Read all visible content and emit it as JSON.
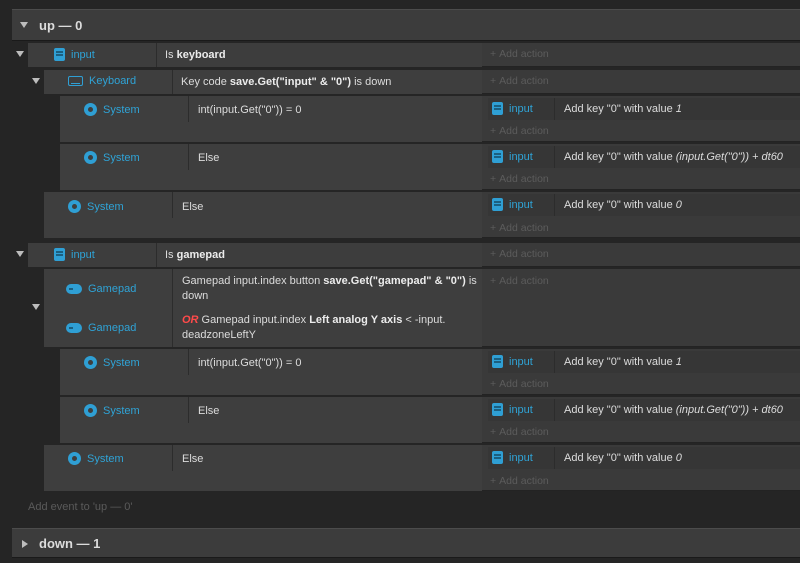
{
  "groups": [
    {
      "title": "up — 0",
      "add_event": "Add event to 'up — 0'"
    },
    {
      "title": "down — 1"
    }
  ],
  "common": {
    "add_action": "Add action",
    "plus": "+"
  },
  "events": {
    "e1": {
      "object": "input",
      "cond_prefix": "Is ",
      "cond_bold": "keyboard"
    },
    "e1a": {
      "object": "Keyboard",
      "cond_prefix": "Key code ",
      "cond_bold": "save.Get(\"input\" & \"0\")",
      "cond_suffix": " is down"
    },
    "e1a1": {
      "object": "System",
      "cond": "int(input.Get(\"0\")) = 0",
      "action_object": "input",
      "action_prefix": "Add key \"0\" with value ",
      "action_value": "1"
    },
    "e1a2": {
      "object": "System",
      "cond": "Else",
      "action_object": "input",
      "action_prefix": "Add key \"0\" with value ",
      "action_value": "(input.Get(\"0\")) + dt60"
    },
    "e1b": {
      "object": "System",
      "cond": "Else",
      "action_object": "input",
      "action_prefix": "Add key \"0\" with value ",
      "action_value": "0"
    },
    "e2": {
      "object": "input",
      "cond_prefix": "Is ",
      "cond_bold": "gamepad"
    },
    "e2a": {
      "object1": "Gamepad",
      "c1_prefix": "Gamepad input.index button ",
      "c1_bold": "save.Get(\"gamepad\" & \"0\")",
      "c1_suffix": " is",
      "c1_line2": "down",
      "object2": "Gamepad",
      "c2_or": "OR",
      "c2_prefix": " Gamepad input.index ",
      "c2_bold": "Left analog Y axis",
      "c2_suffix": " < -input.",
      "c2_line2": "deadzoneLeftY"
    },
    "e2a1": {
      "object": "System",
      "cond": "int(input.Get(\"0\")) = 0",
      "action_object": "input",
      "action_prefix": "Add key \"0\" with value ",
      "action_value": "1"
    },
    "e2a2": {
      "object": "System",
      "cond": "Else",
      "action_object": "input",
      "action_prefix": "Add key \"0\" with value ",
      "action_value": "(input.Get(\"0\")) + dt60"
    },
    "e2b": {
      "object": "System",
      "cond": "Else",
      "action_object": "input",
      "action_prefix": "Add key \"0\" with value ",
      "action_value": "0"
    }
  }
}
